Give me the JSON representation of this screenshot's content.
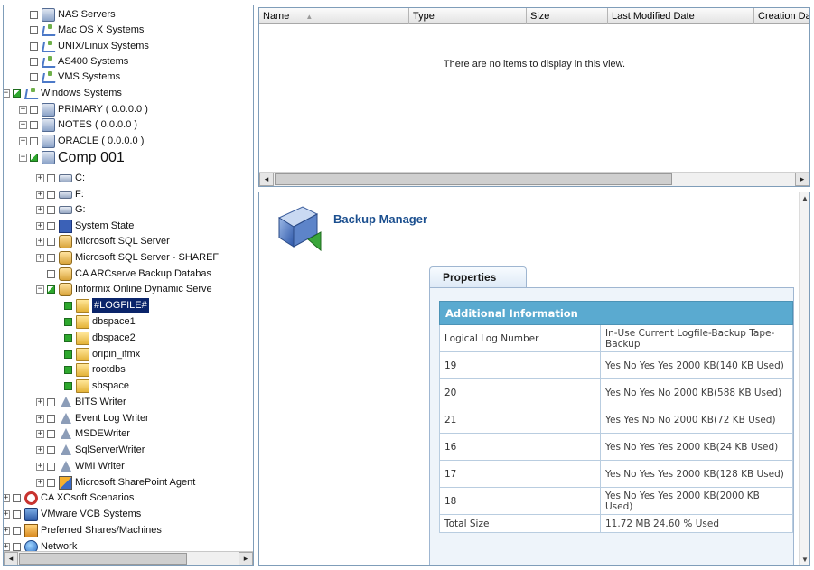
{
  "tree": {
    "items": [
      {
        "label": "NAS Servers",
        "icon": "nas-icon",
        "check": "off",
        "expander": ""
      },
      {
        "label": "Mac OS X Systems",
        "icon": "network-icon",
        "check": "off",
        "expander": ""
      },
      {
        "label": "UNIX/Linux Systems",
        "icon": "network-icon",
        "check": "off",
        "expander": ""
      },
      {
        "label": "AS400 Systems",
        "icon": "network-icon",
        "check": "off",
        "expander": ""
      },
      {
        "label": "VMS Systems",
        "icon": "network-icon",
        "check": "off",
        "expander": ""
      },
      {
        "label": "Windows Systems",
        "icon": "network-icon",
        "check": "half",
        "expander": "−"
      },
      {
        "label": "PRIMARY ( 0.0.0.0 )",
        "icon": "server-icon",
        "check": "off",
        "expander": "+"
      },
      {
        "label": "NOTES ( 0.0.0.0 )",
        "icon": "computer-icon",
        "check": "off",
        "expander": "+"
      },
      {
        "label": "ORACLE ( 0.0.0.0 )",
        "icon": "computer-icon",
        "check": "off",
        "expander": "+"
      },
      {
        "label": "Comp 001",
        "icon": "computer-icon",
        "check": "half",
        "expander": "−"
      },
      {
        "label": "C:",
        "icon": "drive-icon",
        "check": "off",
        "expander": "+"
      },
      {
        "label": "F:",
        "icon": "drive-icon",
        "check": "off",
        "expander": "+"
      },
      {
        "label": "G:",
        "icon": "drive-icon",
        "check": "off",
        "expander": "+"
      },
      {
        "label": "System State",
        "icon": "system-state-icon",
        "check": "off",
        "expander": "+"
      },
      {
        "label": "Microsoft SQL Server",
        "icon": "database-icon",
        "check": "off",
        "expander": "+"
      },
      {
        "label": "Microsoft SQL Server - SHAREF",
        "icon": "database-icon",
        "check": "off",
        "expander": "+"
      },
      {
        "label": "CA ARCserve Backup Databas",
        "icon": "database-icon",
        "check": "off",
        "expander": ""
      },
      {
        "label": "Informix Online Dynamic Serve",
        "icon": "database-icon",
        "check": "half",
        "expander": "−"
      },
      {
        "label": "#LOGFILE#",
        "icon": "folder-icon",
        "check": "on",
        "expander": ""
      },
      {
        "label": "dbspace1",
        "icon": "folder-icon",
        "check": "on",
        "expander": ""
      },
      {
        "label": "dbspace2",
        "icon": "folder-icon",
        "check": "on",
        "expander": ""
      },
      {
        "label": "oripin_ifmx",
        "icon": "folder-icon",
        "check": "on",
        "expander": ""
      },
      {
        "label": "rootdbs",
        "icon": "folder-icon",
        "check": "on",
        "expander": ""
      },
      {
        "label": "sbspace",
        "icon": "folder-icon",
        "check": "on",
        "expander": ""
      },
      {
        "label": "BITS Writer",
        "icon": "writer-icon",
        "check": "off",
        "expander": "+"
      },
      {
        "label": "Event Log Writer",
        "icon": "writer-icon",
        "check": "off",
        "expander": "+"
      },
      {
        "label": "MSDEWriter",
        "icon": "writer-icon",
        "check": "off",
        "expander": "+"
      },
      {
        "label": "SqlServerWriter",
        "icon": "writer-icon",
        "check": "off",
        "expander": "+"
      },
      {
        "label": "WMI Writer",
        "icon": "writer-icon",
        "check": "off",
        "expander": "+"
      },
      {
        "label": "Microsoft SharePoint Agent",
        "icon": "sharepoint-icon",
        "check": "off",
        "expander": "+"
      },
      {
        "label": "CA XOsoft Scenarios",
        "icon": "xosoft-icon",
        "check": "off",
        "expander": "+"
      },
      {
        "label": "VMware VCB Systems",
        "icon": "vmware-icon",
        "check": "off",
        "expander": "+"
      },
      {
        "label": "Preferred Shares/Machines",
        "icon": "shares-icon",
        "check": "off",
        "expander": "+"
      },
      {
        "label": "Network",
        "icon": "globe-icon",
        "check": "off",
        "expander": "+"
      }
    ],
    "selected": "#LOGFILE#"
  },
  "list": {
    "columns": [
      "Name",
      "Type",
      "Size",
      "Last Modified Date",
      "Creation Da"
    ],
    "empty_message": "There are no items to display in this view."
  },
  "detail": {
    "title": "Backup Manager",
    "tab_label": "Properties",
    "table_header": "Additional Information",
    "rows": [
      {
        "key": "Logical Log Number",
        "value": "In-Use Current Logfile-Backup Tape-Backup"
      },
      {
        "key": "19",
        "value": "Yes No Yes Yes 2000 KB(140 KB Used)"
      },
      {
        "key": "20",
        "value": "Yes No Yes No 2000 KB(588 KB Used)"
      },
      {
        "key": "21",
        "value": "Yes Yes No No 2000 KB(72 KB Used)"
      },
      {
        "key": "16",
        "value": "Yes No Yes Yes 2000 KB(24 KB Used)"
      },
      {
        "key": "17",
        "value": "Yes No Yes Yes 2000 KB(128 KB Used)"
      },
      {
        "key": "18",
        "value": "Yes No Yes Yes 2000 KB(2000 KB Used)"
      },
      {
        "key": "Total Size",
        "value": "11.72 MB 24.60 % Used"
      }
    ]
  },
  "colors": {
    "selection": "#0a246a",
    "check_on": "#2ea82e",
    "table_header_bg": "#5aaad0",
    "title_color": "#1b4f8f"
  }
}
